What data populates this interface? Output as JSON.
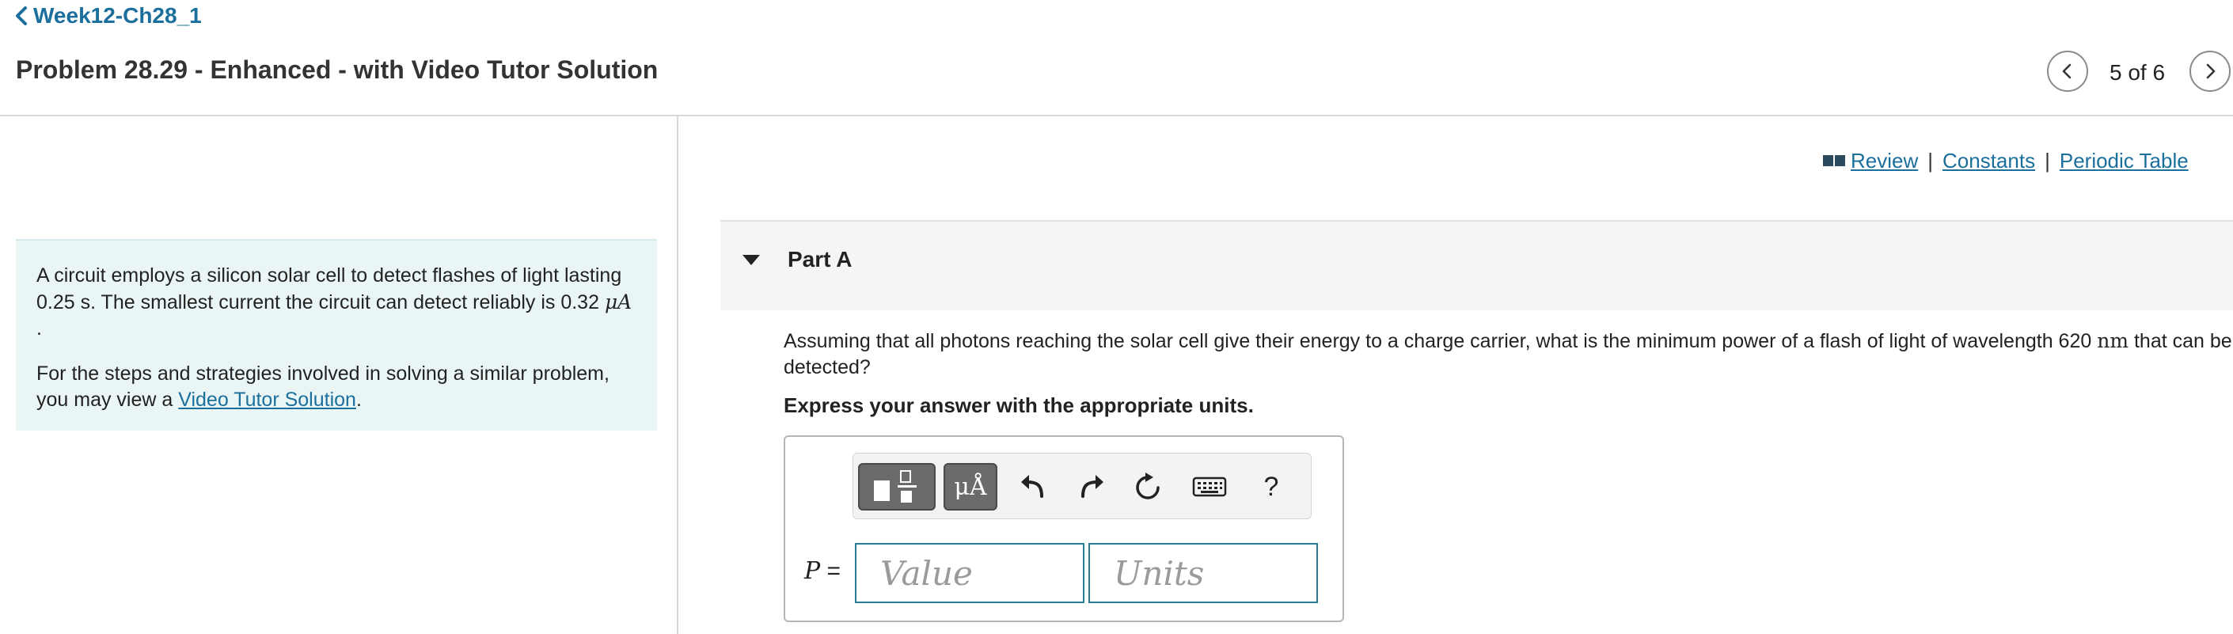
{
  "header": {
    "breadcrumb": "Week12-Ch28_1",
    "title": "Problem 28.29 - Enhanced - with Video Tutor Solution",
    "page_counter": "5 of 6"
  },
  "problem": {
    "text_part1": "A circuit employs a silicon solar cell to detect flashes of light lasting 0.25 s. The smallest current the circuit can detect reliably is 0.32 ",
    "current_unit": "μA",
    "text_part1_end": " .",
    "text_part2": "For the steps and strategies involved in solving a similar problem, you may view a ",
    "video_link": "Video Tutor Solution",
    "text_part2_end": "."
  },
  "resources": {
    "review": "Review",
    "separator": "|",
    "constants": "Constants",
    "periodic_table": "Periodic Table"
  },
  "part": {
    "title": "Part A",
    "question_part1": "Assuming that all photons reaching the solar cell give their energy to a charge carrier, what is the minimum power of a flash of light of wavelength 620 ",
    "wavelength_unit": "nm",
    "question_part2": " that can be detected?",
    "instruction": "Express your answer with the appropriate units."
  },
  "answer": {
    "variable": "P",
    "equals": " =",
    "value_placeholder": "Value",
    "units_placeholder": "Units",
    "units_button_glyph": "μÅ",
    "help_glyph": "?"
  },
  "icons": {
    "breadcrumb": "chevron-left-icon",
    "prev": "chevron-left-icon",
    "next": "chevron-right-icon",
    "review": "book-icon",
    "templates": "templates-icon",
    "undo": "undo-icon",
    "redo": "redo-icon",
    "reset": "reset-icon",
    "keyboard": "keyboard-icon"
  },
  "colors": {
    "link": "#1b6f9c",
    "problem_bg": "#eaf5f6",
    "input_border": "#2a7a93"
  }
}
